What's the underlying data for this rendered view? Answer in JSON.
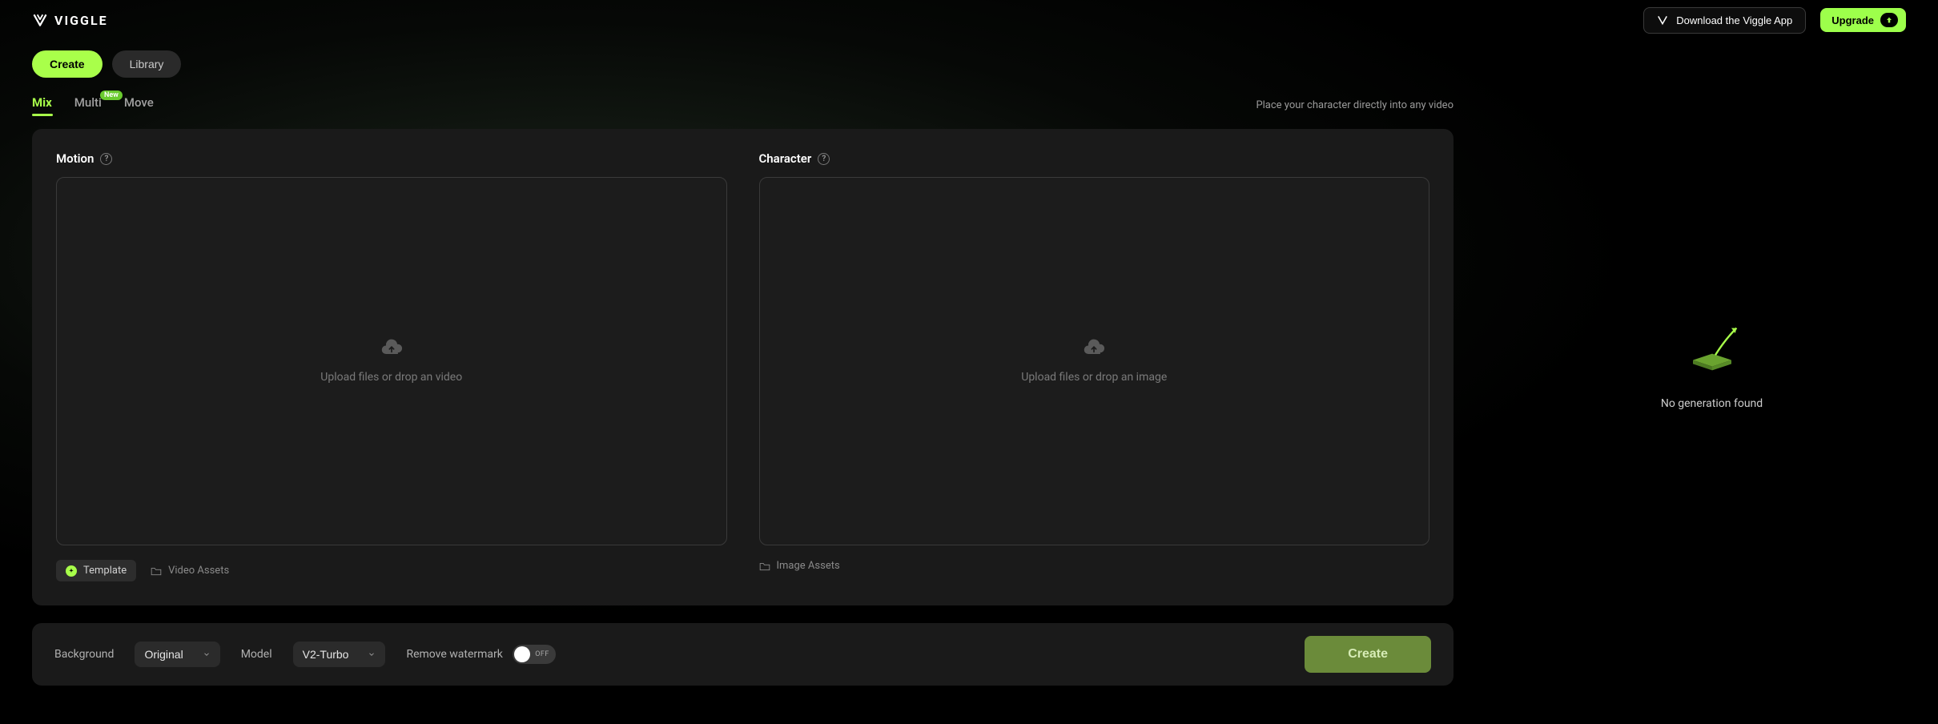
{
  "brand": "VIGGLE",
  "header": {
    "download_label": "Download the Viggle App",
    "upgrade_label": "Upgrade"
  },
  "nav": {
    "create": "Create",
    "library": "Library"
  },
  "tabs": {
    "mix": "Mix",
    "multi": "Multi",
    "multi_badge": "New",
    "move": "Move"
  },
  "tagline": "Place your character directly into any video",
  "motion": {
    "title": "Motion",
    "drop_text": "Upload files or drop an video",
    "template_label": "Template",
    "video_assets_label": "Video Assets"
  },
  "character": {
    "title": "Character",
    "drop_text": "Upload files or drop an image",
    "image_assets_label": "Image Assets"
  },
  "controls": {
    "background_label": "Background",
    "background_value": "Original",
    "model_label": "Model",
    "model_value": "V2-Turbo",
    "watermark_label": "Remove watermark",
    "watermark_state": "OFF",
    "create_button": "Create"
  },
  "right_panel": {
    "empty_text": "No generation found"
  }
}
